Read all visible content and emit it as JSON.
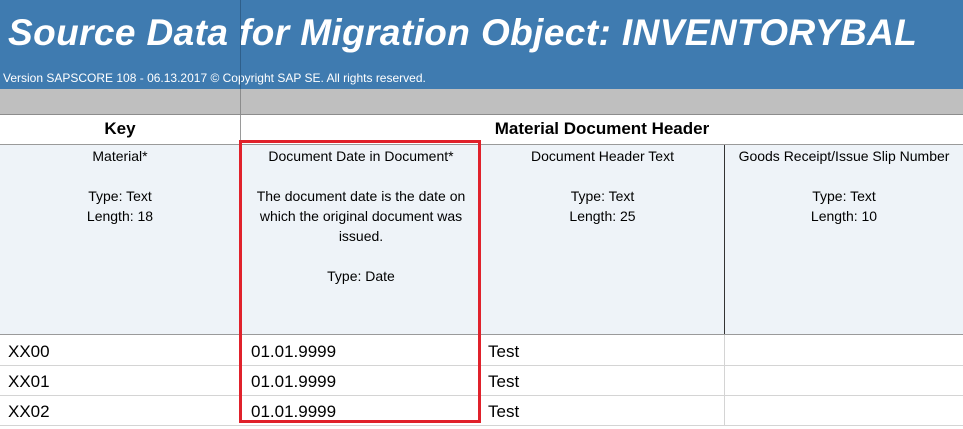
{
  "banner": {
    "title": "Source Data for Migration Object:  INVENTORYBAL",
    "version": "Version SAPSCORE 108  - 06.13.2017 © Copyright SAP SE. All rights reserved."
  },
  "groups": {
    "key": "Key",
    "material_document_header": "Material Document Header"
  },
  "columns": [
    {
      "title": "Material*",
      "description": "",
      "type": "Type: Text",
      "length": "Length: 18"
    },
    {
      "title": "Document Date in Document*",
      "description": "The document date is the date on which the original document was issued.",
      "type": "Type: Date",
      "length": ""
    },
    {
      "title": "Document Header Text",
      "description": "",
      "type": "Type: Text",
      "length": "Length: 25"
    },
    {
      "title": "Goods Receipt/Issue Slip Number",
      "description": "",
      "type": "Type: Text",
      "length": "Length: 10"
    }
  ],
  "rows": [
    {
      "material": "XX00",
      "doc_date": "01.01.9999",
      "header_text": "Test",
      "slip_number": ""
    },
    {
      "material": "XX01",
      "doc_date": "01.01.9999",
      "header_text": "Test",
      "slip_number": ""
    },
    {
      "material": "XX02",
      "doc_date": "01.01.9999",
      "header_text": "Test",
      "slip_number": ""
    }
  ],
  "colors": {
    "banner": "#3f7bb0",
    "highlight": "#e0212b",
    "description_background": "#eef3f8"
  }
}
